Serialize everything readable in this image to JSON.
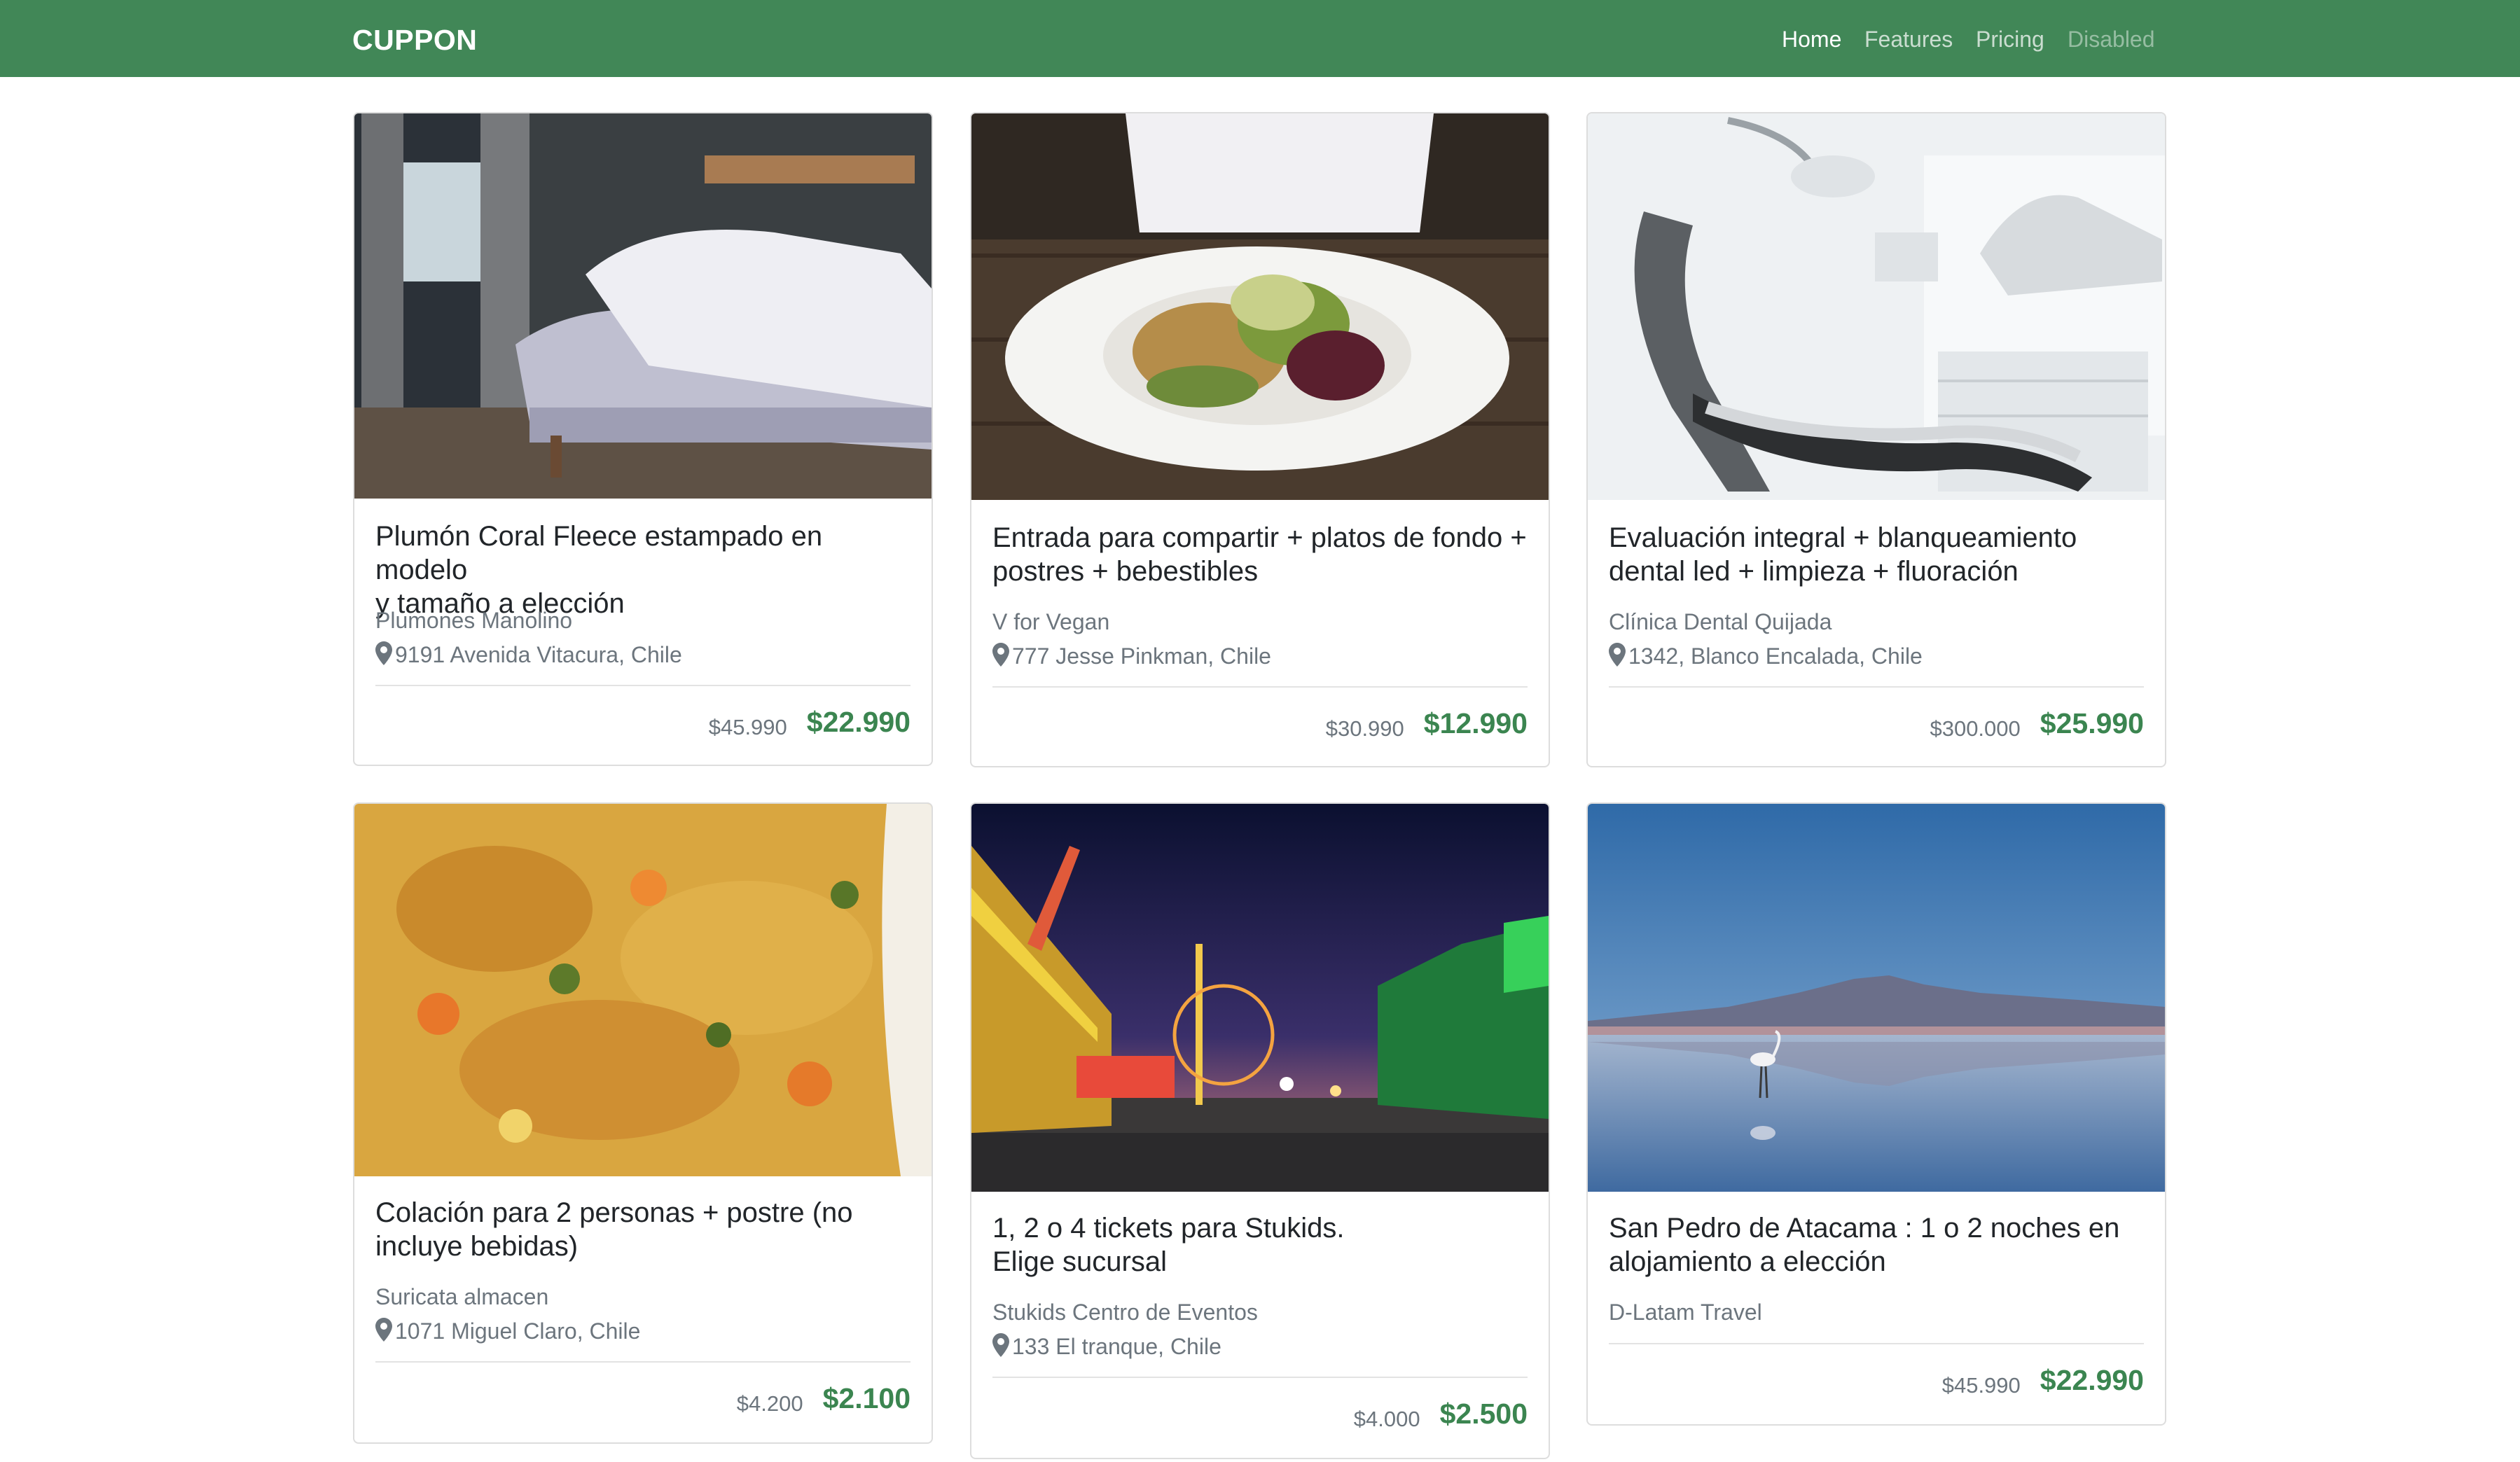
{
  "navbar": {
    "brand": "CUPPON",
    "links": [
      {
        "label": "Home",
        "state": "active"
      },
      {
        "label": "Features",
        "state": "normal"
      },
      {
        "label": "Pricing",
        "state": "normal"
      },
      {
        "label": "Disabled",
        "state": "disabled"
      }
    ],
    "background_color": "#418757"
  },
  "deals": [
    {
      "title_line1": "Plumón Coral Fleece estampado en modelo",
      "title_line2": "y tamaño a elección",
      "merchant": "Plumones Manolino",
      "address": "9191 Avenida Vitacura, Chile",
      "old_price": "$45.990",
      "price": "$22.990",
      "image": "bedroom-photo"
    },
    {
      "title_line1": "Entrada para compartir + platos de fondo +",
      "title_line2": "postres + bebestibles",
      "merchant": "V for Vegan",
      "address": "777 Jesse Pinkman, Chile",
      "old_price": "$30.990",
      "price": "$12.990",
      "image": "vegan-salad-plate-photo"
    },
    {
      "title_line1": "Evaluación integral + blanqueamiento",
      "title_line2": "dental led + limpieza + fluoración",
      "merchant": "Clínica Dental Quijada",
      "address": "1342, Blanco Encalada, Chile",
      "old_price": "$300.000",
      "price": "$25.990",
      "image": "dental-chair-photo"
    },
    {
      "title_line1": "Colación para 2 personas + postre (no",
      "title_line2": "incluye bebidas)",
      "merchant": "Suricata almacen",
      "address": "1071 Miguel Claro, Chile",
      "old_price": "$4.200",
      "price": "$2.100",
      "image": "rice-dish-photo"
    },
    {
      "title_line1": "1, 2 o 4 tickets para Stukids.",
      "title_line2": "Elige sucursal",
      "merchant": "Stukids Centro de Eventos",
      "address": "133 El tranque, Chile",
      "old_price": "$4.000",
      "price": "$2.500",
      "image": "amusement-park-night-photo"
    },
    {
      "title_line1": "San Pedro de Atacama : 1 o 2 noches en",
      "title_line2": "alojamiento a elección",
      "merchant": "D-Latam Travel",
      "old_price": "$45.990",
      "price": "$22.990",
      "image": "flamingo-lagoon-photo"
    }
  ],
  "colors": {
    "price_green": "#3b8550",
    "muted_text": "#6c757d"
  }
}
